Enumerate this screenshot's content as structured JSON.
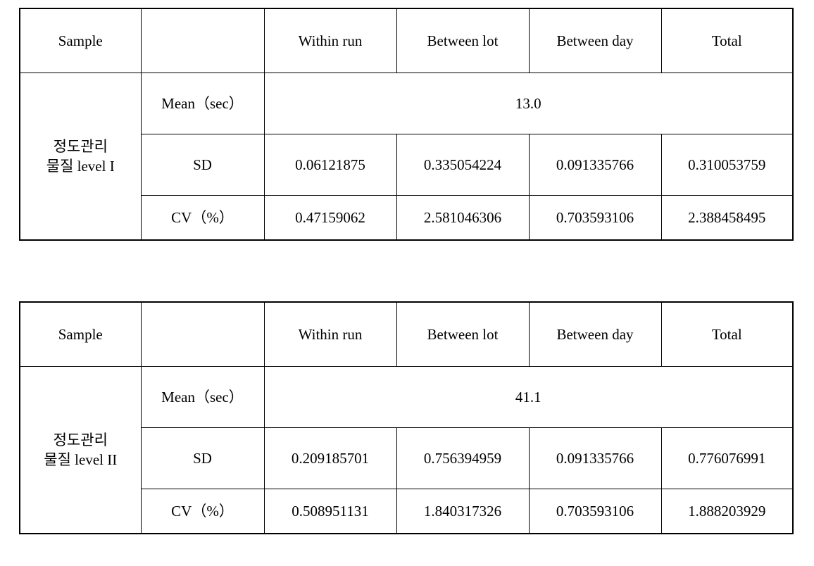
{
  "tables": [
    {
      "id": "quality-control-level-1",
      "header": {
        "sample_label": "Sample",
        "stat_label": "",
        "columns": [
          "Within run",
          "Between lot",
          "Between day",
          "Total"
        ]
      },
      "sample": {
        "line1": "정도관리",
        "line2": "물질 level I"
      },
      "rows": [
        {
          "label": "Mean（sec）",
          "spanned": true,
          "value": "13.0"
        },
        {
          "label": "SD",
          "spanned": false,
          "values": [
            "0.06121875",
            "0.335054224",
            "0.091335766",
            "0.310053759"
          ]
        },
        {
          "label": "CV（%）",
          "spanned": false,
          "values": [
            "0.47159062",
            "2.581046306",
            "0.703593106",
            "2.388458495"
          ]
        }
      ]
    },
    {
      "id": "quality-control-level-2",
      "header": {
        "sample_label": "Sample",
        "stat_label": "",
        "columns": [
          "Within run",
          "Between lot",
          "Between day",
          "Total"
        ]
      },
      "sample": {
        "line1": "정도관리",
        "line2": "물질 level II"
      },
      "rows": [
        {
          "label": "Mean（sec）",
          "spanned": true,
          "value": "41.1"
        },
        {
          "label": "SD",
          "spanned": false,
          "values": [
            "0.209185701",
            "0.756394959",
            "0.091335766",
            "0.776076991"
          ]
        },
        {
          "label": "CV（%）",
          "spanned": false,
          "values": [
            "0.508951131",
            "1.840317326",
            "0.703593106",
            "1.888203929"
          ]
        }
      ]
    }
  ],
  "style": {
    "border_color": "#000000",
    "text_color": "#000000",
    "background": "#ffffff"
  }
}
